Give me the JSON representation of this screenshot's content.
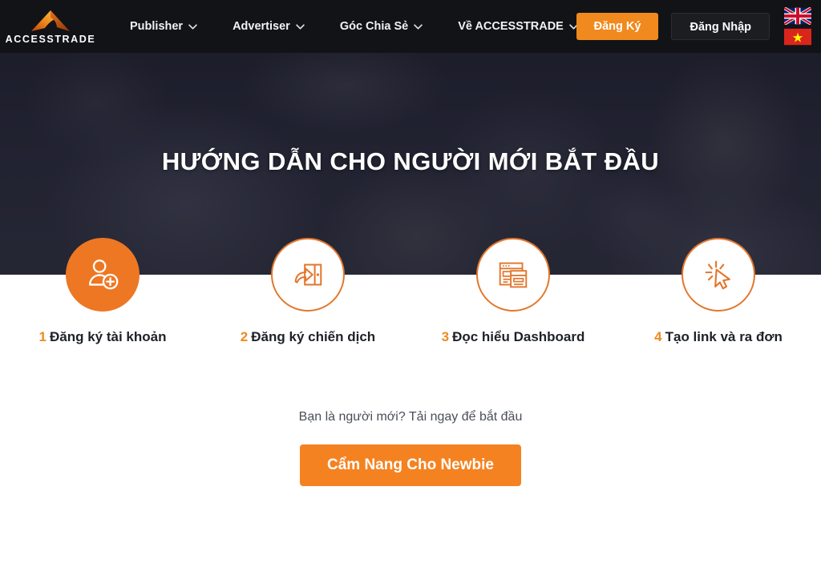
{
  "site": {
    "logo_text": "ACCESSTRADE",
    "logo_icon": "accesstrade-peak-logo"
  },
  "header": {
    "nav_items": [
      {
        "label": "Publisher",
        "icon": "chevron-down-icon",
        "has_dropdown": true
      },
      {
        "label": "Advertiser",
        "icon": "chevron-down-icon",
        "has_dropdown": true
      },
      {
        "label": "Góc Chia Sẻ",
        "icon": "chevron-down-icon",
        "has_dropdown": true
      },
      {
        "label": "Về ACCESSTRADE",
        "icon": "chevron-down-icon",
        "has_dropdown": true
      }
    ],
    "register_label": "Đăng Ký",
    "login_label": "Đăng Nhập",
    "flags": [
      {
        "name": "uk-flag",
        "label": "English"
      },
      {
        "name": "vietnam-flag",
        "label": "Tiếng Việt"
      }
    ]
  },
  "hero": {
    "title": "HƯỚNG DẪN CHO NGƯỜI MỚI BẮT ĐẦU",
    "background": "photo-people-working-dark-overlay"
  },
  "steps": [
    {
      "number": "1",
      "label": "Đăng ký tài khoản",
      "icon": "user-plus-icon",
      "style": "solid"
    },
    {
      "number": "2",
      "label": "Đăng ký chiến dịch",
      "icon": "door-enter-arrow-icon",
      "style": "hollow"
    },
    {
      "number": "3",
      "label": "Đọc hiểu Dashboard",
      "icon": "browser-windows-icon",
      "style": "hollow"
    },
    {
      "number": "4",
      "label": "Tạo link và ra đơn",
      "icon": "cursor-click-icon",
      "style": "hollow"
    }
  ],
  "cta": {
    "text": "Bạn là người mới? Tải ngay để bắt đầu",
    "button_label": "Cẩm Nang Cho Newbie"
  },
  "colors": {
    "brand_orange": "#F08A1E",
    "accent_orange": "#EE7723",
    "header_dark": "#121317",
    "hero_navy": "#2b2c3c",
    "text_dark": "#1e2128"
  }
}
